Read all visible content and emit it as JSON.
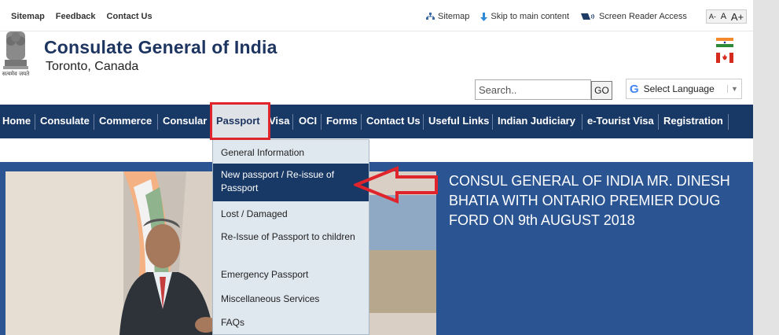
{
  "topbar": {
    "links": [
      "Sitemap",
      "Feedback",
      "Contact Us"
    ],
    "sitemap_label": "Sitemap",
    "skip_label": "Skip to main content",
    "reader_label": "Screen Reader Access",
    "font_small": "A-",
    "font_normal": "A",
    "font_large": "A+"
  },
  "header": {
    "title": "Consulate General of India",
    "subtitle": "Toronto, Canada",
    "emblem_motto": "सत्यमेव जयते",
    "search_placeholder": "Search..",
    "search_button": "GO",
    "language_label": "Select Language"
  },
  "nav": {
    "items": [
      "Home",
      "Consulate",
      "Commerce",
      "Consular",
      "Passport",
      "Visa",
      "OCI",
      "Forms",
      "Contact Us",
      "Useful Links",
      "Indian Judiciary",
      "e-Tourist Visa",
      "Registration"
    ],
    "active": "Passport"
  },
  "dropdown": {
    "items": [
      "General Information",
      "New passport / Re-issue of Passport",
      "Lost / Damaged",
      "Re-Issue of Passport to children",
      "Emergency Passport",
      "Miscellaneous Services",
      "FAQs"
    ],
    "highlighted": "New passport / Re-issue of Passport"
  },
  "banner": {
    "caption": "CONSUL GENERAL OF INDIA MR. DINESH BHATIA WITH ONTARIO PREMIER DOUG FORD ON 9th AUGUST 2018"
  },
  "colors": {
    "nav_bg": "#183865",
    "title": "#1d3560",
    "banner_bg": "#2a5592",
    "highlight_box": "#e0242b"
  }
}
